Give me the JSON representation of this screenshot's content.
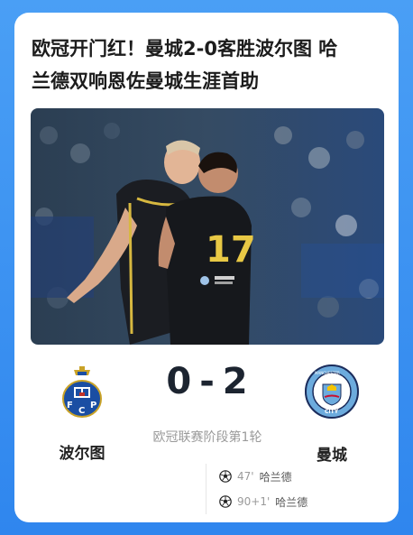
{
  "article": {
    "title_line1": "欧冠开门红！曼城2-0客胜波尔图 哈",
    "title_line2": "兰德双响恩佐曼城生涯首助"
  },
  "photo": {
    "jersey_number": "17"
  },
  "match": {
    "home_team": "波尔图",
    "away_team": "曼城",
    "home_score": "0",
    "separator": "-",
    "away_score": "2",
    "competition": "欧冠联赛阶段第1轮",
    "goals": [
      {
        "minute": "47'",
        "player": "哈兰德",
        "icon": "soccer-ball-icon"
      },
      {
        "minute": "90+1'",
        "player": "哈兰德",
        "icon": "soccer-ball-icon"
      }
    ]
  },
  "colors": {
    "background": "#3b93f2",
    "card": "#ffffff",
    "score": "#1c2430",
    "muted": "#9a9a9a"
  }
}
